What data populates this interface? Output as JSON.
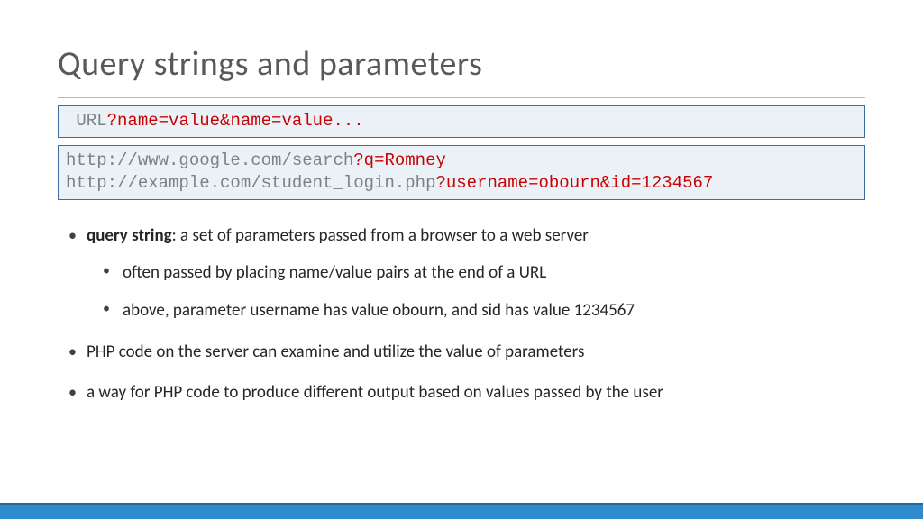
{
  "title": "Query strings and parameters",
  "syntax": {
    "base": "URL",
    "query": "?name=value&name=value..."
  },
  "examples": [
    {
      "base": "http://www.google.com/search",
      "query": "?q=Romney"
    },
    {
      "base": "http://example.com/student_login.php",
      "query": "?username=obourn&id=1234567"
    }
  ],
  "bullets": {
    "b1_strong": "query string",
    "b1_rest": ": a set of parameters passed from a browser to a web server",
    "b1_sub1": "often passed by placing name/value pairs at the end of a URL",
    "b1_sub2": "above, parameter username has value obourn, and sid has value 1234567",
    "b2": "PHP code on the server can examine and utilize the value of parameters",
    "b3": "a way for PHP code to produce different output based on values passed by the user"
  }
}
